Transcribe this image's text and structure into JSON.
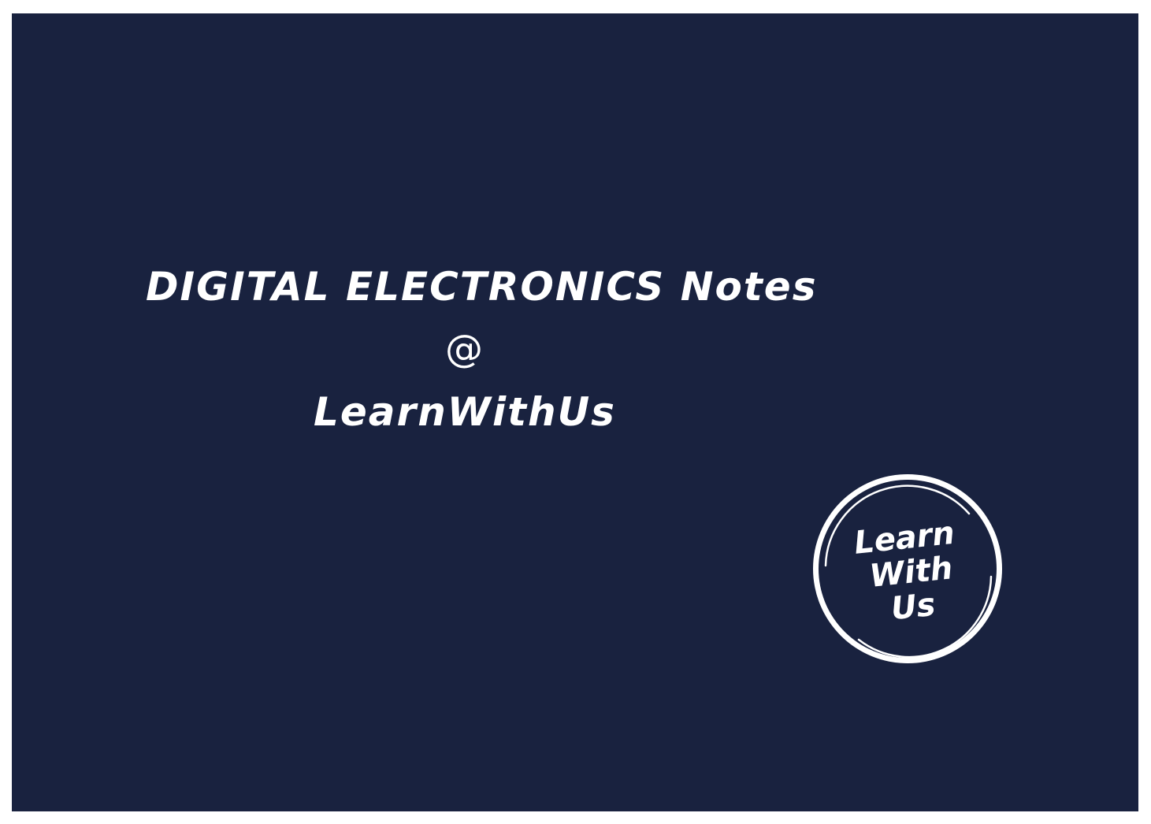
{
  "cover": {
    "title": "DIGITAL ELECTRONICS Notes",
    "at_symbol": "@",
    "brand": "LearnWithUs",
    "background_color": "#19223f",
    "text_color": "#ffffff"
  },
  "logo": {
    "icon": "learn-with-us-badge-icon",
    "line1": "Learn",
    "line2": "With",
    "line3": "Us"
  }
}
